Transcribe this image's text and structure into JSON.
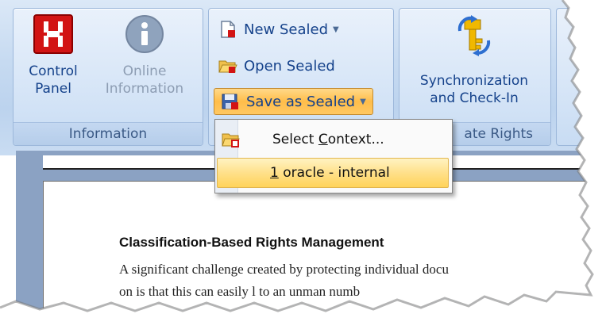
{
  "ribbon": {
    "groups": {
      "information": {
        "label": "Information",
        "control_panel": {
          "line1": "Control",
          "line2": "Panel"
        },
        "online_information": {
          "line1": "Online",
          "line2": "Information"
        }
      },
      "sealing": {
        "new_sealed": "New Sealed",
        "open_sealed": "Open Sealed",
        "save_as_sealed": "Save as Sealed"
      },
      "rights": {
        "label": "ate Rights",
        "sync": {
          "line1": "Synchronization",
          "line2": "and Check-In"
        }
      }
    }
  },
  "menu": {
    "select_context": {
      "prefix": "Select ",
      "accel": "C",
      "suffix": "ontext..."
    },
    "recent": {
      "accel": "1",
      "text": " oracle - internal"
    }
  },
  "document": {
    "heading": "Classification-Based Rights Management",
    "line1": "A significant challenge created by protecting individual docu",
    "line2": "on is that this can      easily l     to an unman       numb"
  },
  "colors": {
    "accent": "#15428b",
    "highlight": "#ffd35a",
    "doc_background": "#8ba2c3"
  }
}
